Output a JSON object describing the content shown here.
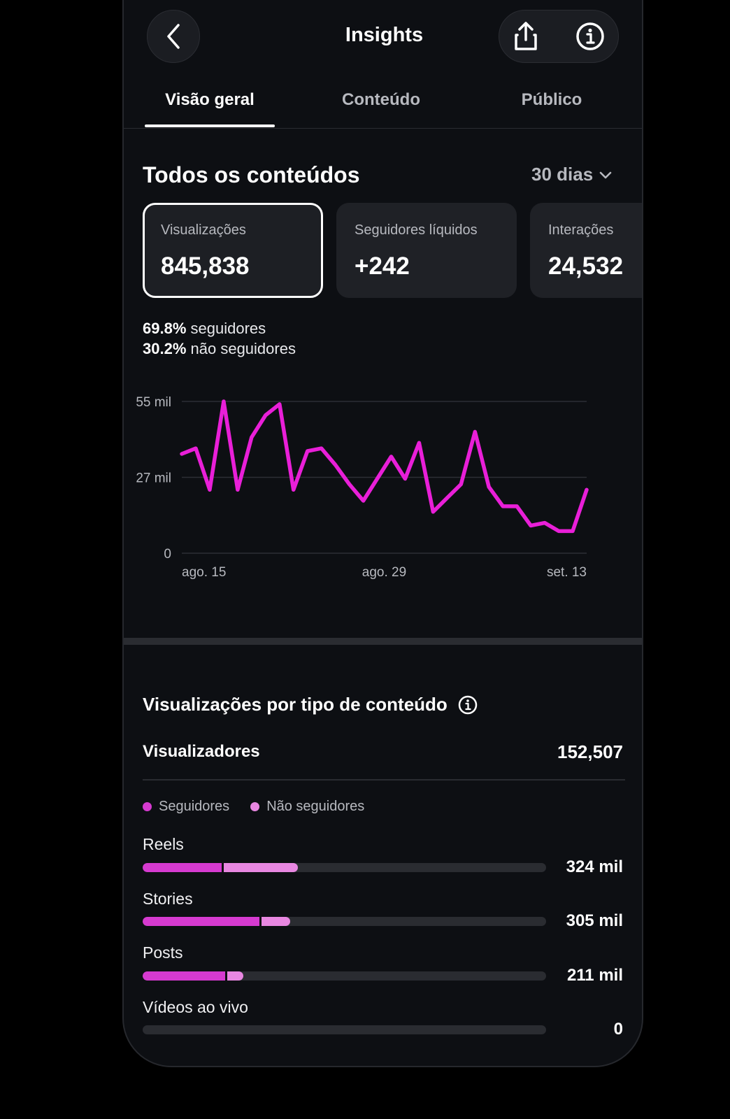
{
  "header": {
    "title": "Insights"
  },
  "tabs": [
    {
      "label": "Visão geral",
      "active": true
    },
    {
      "label": "Conteúdo",
      "active": false
    },
    {
      "label": "Público",
      "active": false
    }
  ],
  "overview": {
    "title": "Todos os conteúdos",
    "range": "30 dias",
    "cards": [
      {
        "label": "Visualizações",
        "value": "845,838",
        "selected": true
      },
      {
        "label": "Seguidores líquidos",
        "value": "+242",
        "selected": false
      },
      {
        "label": "Interações",
        "value": "24,532",
        "selected": false
      }
    ],
    "split": [
      {
        "pct": "69.8%",
        "label": "seguidores"
      },
      {
        "pct": "30.2%",
        "label": "não seguidores"
      }
    ]
  },
  "chart_data": {
    "type": "line",
    "x_tick_labels": [
      "ago. 15",
      "ago. 29",
      "set. 13"
    ],
    "y_tick_labels": [
      "55 mil",
      "27 mil",
      "0"
    ],
    "ylim": [
      0,
      55
    ],
    "grid": true,
    "color": "#e91fd8",
    "series": [
      {
        "values": [
          36,
          38,
          23,
          55,
          23,
          42,
          50,
          54,
          23,
          37,
          38,
          32,
          25,
          19,
          27,
          35,
          27,
          40,
          15,
          20,
          25,
          44,
          24,
          17,
          17,
          10,
          11,
          8,
          8,
          23
        ]
      }
    ]
  },
  "by_type": {
    "title": "Visualizações por tipo de conteúdo",
    "viewers_label": "Visualizadores",
    "viewers_value": "152,507",
    "legend": [
      {
        "label": "Seguidores",
        "color": "#d63ad0"
      },
      {
        "label": "Não seguidores",
        "color": "#e887e1"
      }
    ],
    "rows": [
      {
        "label": "Reels",
        "value": "324 mil",
        "followers_fraction": 0.195,
        "nonfollowers_fraction": 0.19
      },
      {
        "label": "Stories",
        "value": "305 mil",
        "followers_fraction": 0.29,
        "nonfollowers_fraction": 0.075
      },
      {
        "label": "Posts",
        "value": "211 mil",
        "followers_fraction": 0.205,
        "nonfollowers_fraction": 0.045
      },
      {
        "label": "Vídeos ao vivo",
        "value": "0",
        "followers_fraction": 0,
        "nonfollowers_fraction": 0
      }
    ]
  }
}
